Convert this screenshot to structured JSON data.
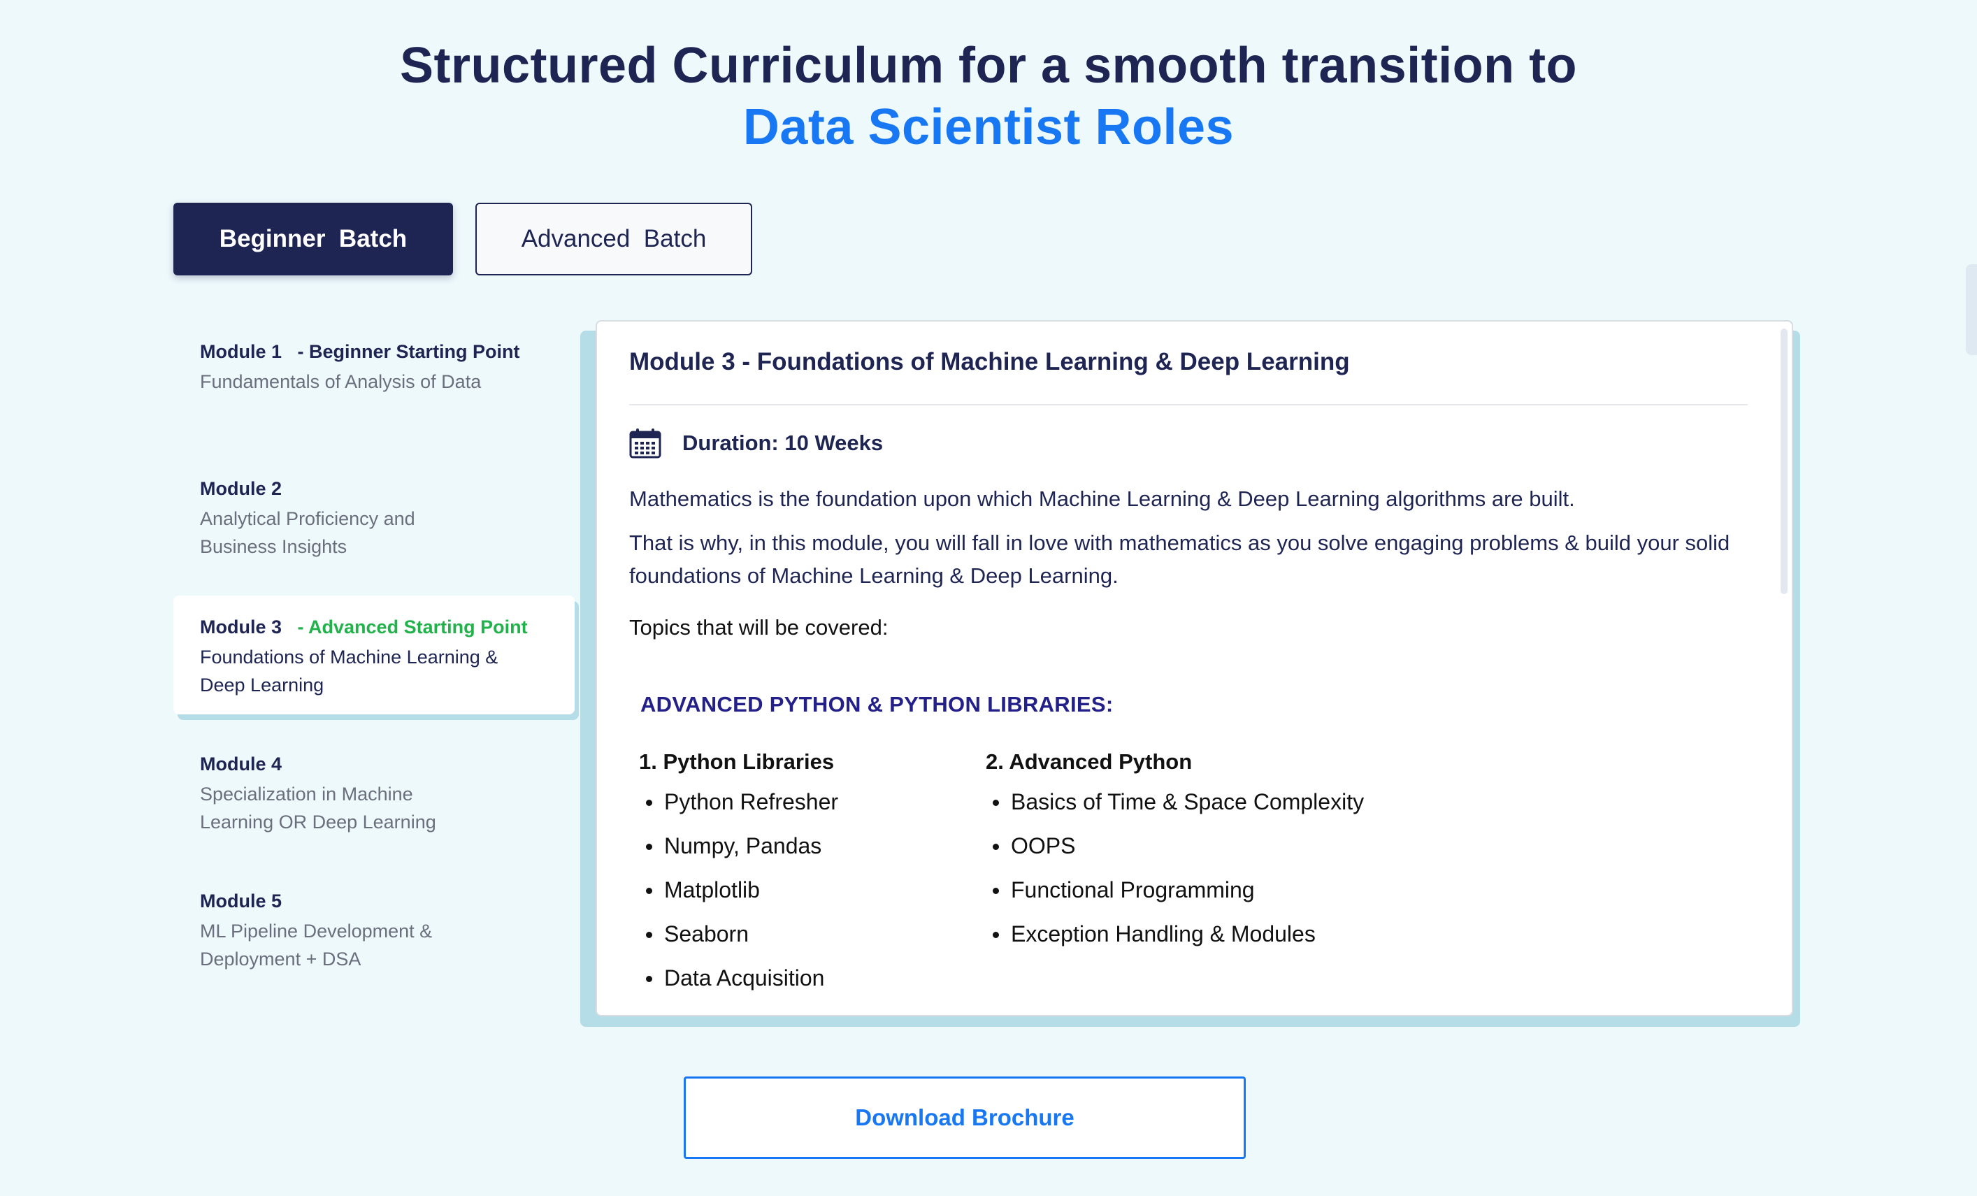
{
  "header": {
    "line1": "Structured Curriculum for a smooth transition to",
    "line2": "Data Scientist Roles",
    "accent_color": "#1877f2"
  },
  "batch_tabs": [
    {
      "label": "Beginner  Batch",
      "active": true
    },
    {
      "label": "Advanced  Batch",
      "active": false
    }
  ],
  "modules": [
    {
      "title": "Module 1",
      "tag": "- Beginner Starting Point",
      "sub": "Fundamentals of Analysis of Data"
    },
    {
      "title": "Module 2",
      "tag": "",
      "sub": "Analytical Proficiency and Business Insights"
    },
    {
      "title": "Module 3",
      "tag": "- Advanced Starting Point",
      "sub": "Foundations of Machine Learning & Deep Learning"
    },
    {
      "title": "Module 4",
      "tag": "",
      "sub": "Specialization in Machine Learning OR Deep Learning"
    },
    {
      "title": "Module 5",
      "tag": "",
      "sub": "ML Pipeline Development & Deployment + DSA"
    }
  ],
  "detail": {
    "title": "Module 3 - Foundations of Machine Learning & Deep Learning",
    "duration_label": "Duration: 10 Weeks",
    "para1": "Mathematics is the foundation upon which Machine Learning & Deep Learning algorithms are built.",
    "para2": "That is why, in this module, you will fall in love with mathematics as you solve engaging problems & build your solid foundations of Machine Learning & Deep Learning.",
    "topics_label": "Topics that will be covered:",
    "section_head": "ADVANCED PYTHON & PYTHON LIBRARIES:",
    "columns": [
      {
        "heading": "1. Python Libraries",
        "items": [
          "Python Refresher",
          "Numpy, Pandas",
          "Matplotlib",
          "Seaborn",
          "Data Acquisition"
        ]
      },
      {
        "heading": "2. Advanced Python",
        "items": [
          "Basics of Time & Space Complexity",
          "OOPS",
          "Functional Programming",
          "Exception Handling & Modules"
        ]
      }
    ]
  },
  "download_button": "Download Brochure",
  "icons": {
    "calendar": "calendar-icon"
  }
}
